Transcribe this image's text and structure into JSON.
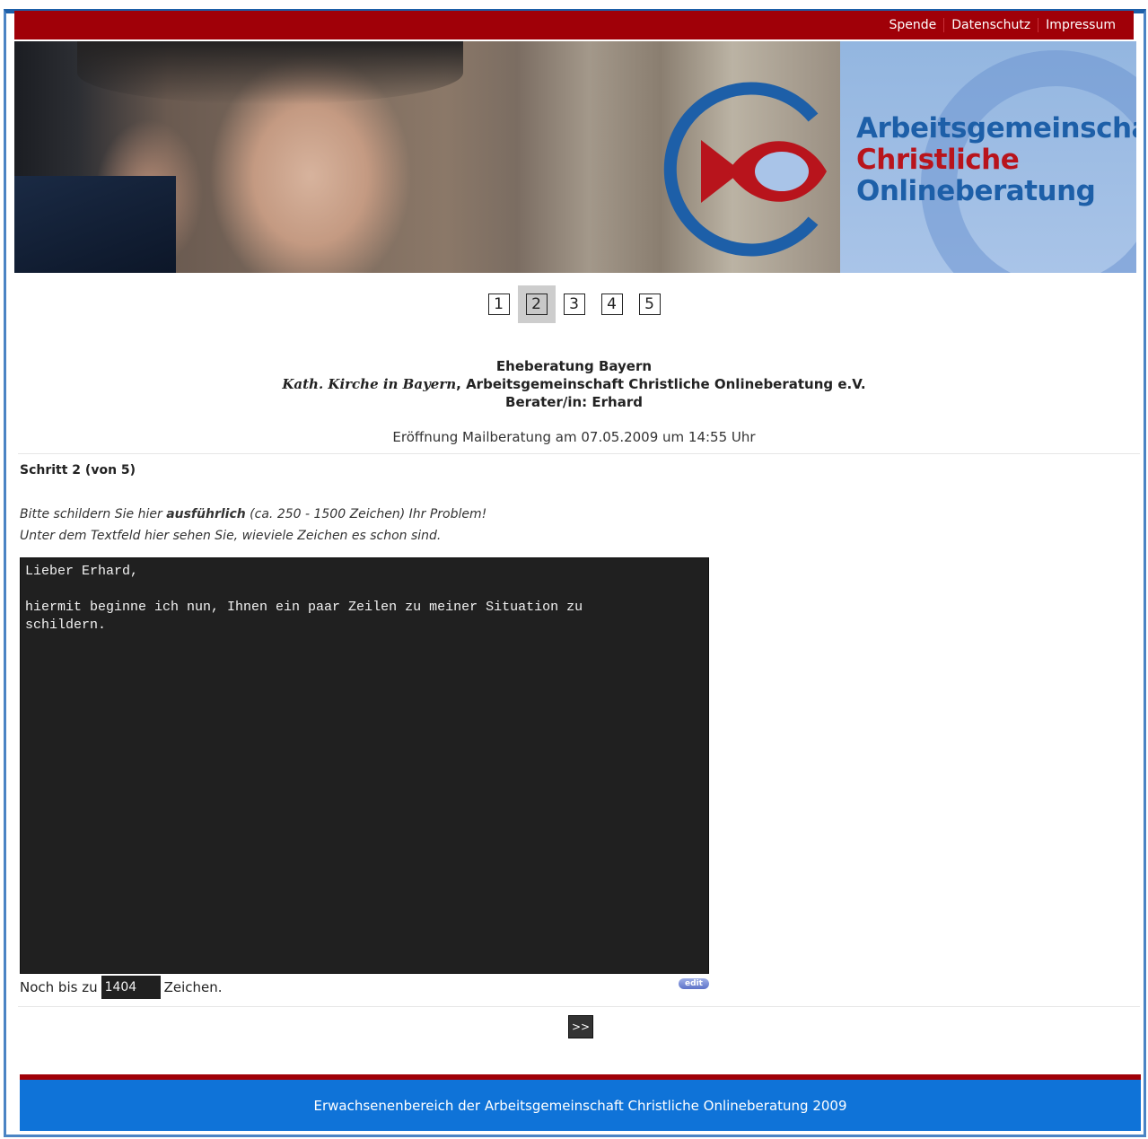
{
  "topnav": {
    "links": [
      "Spende",
      "Datenschutz",
      "Impressum"
    ]
  },
  "banner": {
    "logo_line1": "Arbeitsgemeinschaft",
    "logo_line2": "Christliche",
    "logo_line3": "Onlineberatung"
  },
  "steps": {
    "items": [
      "1",
      "2",
      "3",
      "4",
      "5"
    ],
    "active": "2"
  },
  "info": {
    "title": "Eheberatung Bayern",
    "org_italic": "Kath. Kirche in Bayern",
    "org_rest": ", Arbeitsgemeinschaft Christliche Onlineberatung e.V.",
    "counselor": "Berater/in: Erhard",
    "opening": "Eröffnung Mailberatung am 07.05.2009 um 14:55 Uhr"
  },
  "form": {
    "step_label": "Schritt 2 (von 5)",
    "instr_prefix": "Bitte schildern Sie hier ",
    "instr_bold": "ausführlich",
    "instr_suffix": " (ca. 250 - 1500 Zeichen) Ihr Problem!",
    "instr_line2": "Unter dem Textfeld hier sehen Sie, wieviele Zeichen es schon sind.",
    "message": "Lieber Erhard,\n\nhiermit beginne ich nun, Ihnen ein paar Zeilen zu meiner Situation zu\nschildern.",
    "counter_prefix": "Noch bis zu",
    "counter_value": "1404",
    "counter_suffix": "Zeichen.",
    "edit_label": "edit",
    "next_label": ">>"
  },
  "footer": {
    "text": "Erwachsenenbereich der Arbeitsgemeinschaft Christliche Onlineberatung 2009"
  },
  "colors": {
    "topbar": "#a00008",
    "footer": "#0f73d8",
    "frame": "#1d5fa8",
    "logo_blue": "#1d5fa8",
    "logo_red": "#b8141c"
  }
}
